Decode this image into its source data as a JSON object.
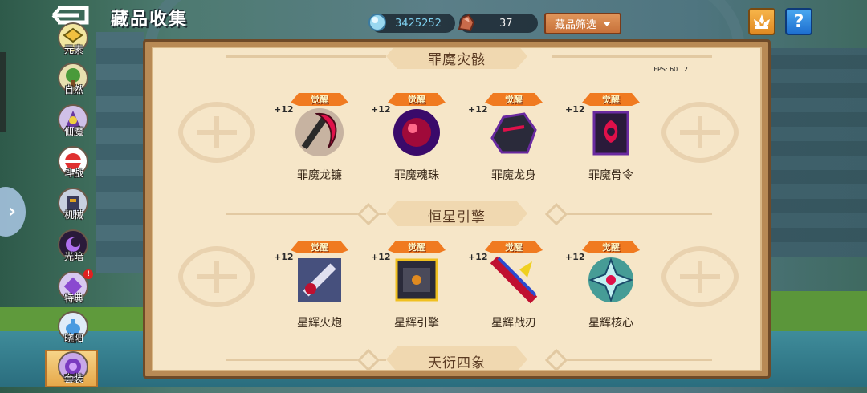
{
  "header": {
    "title": "藏品收集",
    "gems": "3425252",
    "ore": "37",
    "filter_label": "藏品筛选",
    "help_label": "?"
  },
  "sidebar": {
    "items": [
      {
        "label": "元素",
        "icon": "element-icon"
      },
      {
        "label": "自然",
        "icon": "tree-icon"
      },
      {
        "label": "仙魔",
        "icon": "demon-icon"
      },
      {
        "label": "斗战",
        "icon": "battle-orb-icon"
      },
      {
        "label": "机械",
        "icon": "mech-icon"
      },
      {
        "label": "光暗",
        "icon": "light-dark-icon"
      },
      {
        "label": "特典",
        "icon": "special-icon",
        "badge": "!"
      },
      {
        "label": "晓阳",
        "icon": "teapot-icon"
      },
      {
        "label": "套装",
        "icon": "set-icon",
        "selected": true
      }
    ]
  },
  "fps": "FPS: 60.12",
  "sections": [
    {
      "title": "罪魔灾骸",
      "items": [
        {
          "name": "罪魔龙镰",
          "level": "+12",
          "badge": "觉醒",
          "icon": "scythe-icon"
        },
        {
          "name": "罪魔魂珠",
          "level": "+12",
          "badge": "觉醒",
          "icon": "soul-orb-icon"
        },
        {
          "name": "罪魔龙身",
          "level": "+12",
          "badge": "觉醒",
          "icon": "dragon-body-icon"
        },
        {
          "name": "罪魔骨令",
          "level": "+12",
          "badge": "觉醒",
          "icon": "bone-token-icon"
        }
      ]
    },
    {
      "title": "恒星引擎",
      "items": [
        {
          "name": "星辉火炮",
          "level": "+12",
          "badge": "觉醒",
          "icon": "cannon-icon"
        },
        {
          "name": "星辉引擎",
          "level": "+12",
          "badge": "觉醒",
          "icon": "engine-icon"
        },
        {
          "name": "星辉战刃",
          "level": "+12",
          "badge": "觉醒",
          "icon": "blade-icon"
        },
        {
          "name": "星辉核心",
          "level": "+12",
          "badge": "觉醒",
          "icon": "core-icon"
        }
      ]
    },
    {
      "title": "天衍四象",
      "items": []
    }
  ],
  "colors": {
    "panel_bg": "#f6e6c8",
    "frame": "#b88a55",
    "badge_red": "#e02020",
    "gem_text": "#7fd1f0"
  }
}
